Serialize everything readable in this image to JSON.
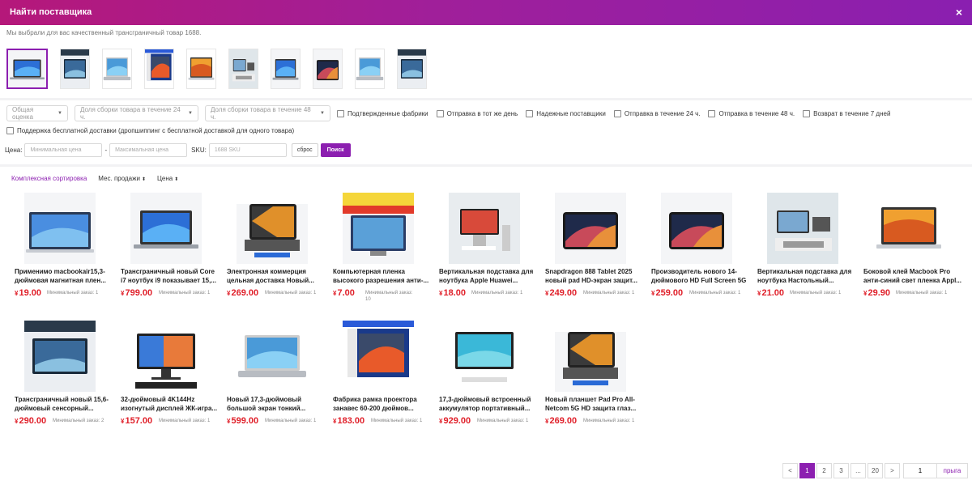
{
  "header": {
    "title": "Найти поставщика",
    "close_label": "×"
  },
  "subtitle": "Мы выбрали для вас качественный трансграничный товар 1688.",
  "thumbnails": [
    "laptop-1",
    "poster-1",
    "laptop-2",
    "screen-1",
    "screen-2",
    "dock-1",
    "laptop-3",
    "dark-1",
    "laptop-4",
    "laptop-5"
  ],
  "filters": {
    "rating": "Общая оценка",
    "pack24": "Доля сборки товара в течение 24 ч.",
    "pack48": "Доля сборки товара в течение 48 ч.",
    "checkboxes": [
      "Подтвержденные фабрики",
      "Отправка в тот же день",
      "Надежные поставщики",
      "Отправка в течение 24 ч.",
      "Отправка в течение 48 ч.",
      "Возврат в течение 7 дней"
    ],
    "free_shipping": "Поддержка бесплатной доставки (дропшиппинг с бесплатной доставкой для одного товара)"
  },
  "price_filter": {
    "label": "Цена:",
    "min_placeholder": "Минимальная цена",
    "dash": "-",
    "max_placeholder": "Максимальная цена",
    "sku_label": "SKU:",
    "sku_placeholder": "1688 SKU",
    "reset": "сброс",
    "search": "Поиск"
  },
  "sort": {
    "complex": "Комплексная сортировка",
    "sales": "Мес. продажи",
    "price": "Цена",
    "arrows": "⬍"
  },
  "currency": "¥",
  "products": [
    {
      "name": "Применимо macbookair15,3-дюймовая магнитная плен...",
      "price": "19.00",
      "moq": "Минимальный заказ: 1",
      "img": "screen-film"
    },
    {
      "name": "Трансграничный новый Core i7 ноутбук i9 показывает 15,...",
      "price": "799.00",
      "moq": "Минимальный заказ: 1",
      "img": "laptop"
    },
    {
      "name": "Электронная коммерция цельная доставка Новый...",
      "price": "269.00",
      "moq": "Минимальный заказ: 1",
      "img": "tablet-kb"
    },
    {
      "name": "Компьютерная пленка высокого разрешения анти-...",
      "price": "7.00",
      "moq": "Минимальный заказ: 10",
      "img": "privacy"
    },
    {
      "name": "Вертикальная подставка для ноутбука Apple Huawei...",
      "price": "18.00",
      "moq": "Минимальный заказ: 1",
      "img": "stand"
    },
    {
      "name": "Snapdragon 888 Tablet 2025 новый pad HD-экран защит...",
      "price": "249.00",
      "moq": "Минимальный заказ: 1",
      "img": "tablet"
    },
    {
      "name": "Производитель нового 14-дюймового HD Full Screen 5G",
      "price": "259.00",
      "moq": "Минимальный заказ: 1",
      "img": "tablet"
    },
    {
      "name": "Вертикальная подставка для ноутбука Настольный...",
      "price": "21.00",
      "moq": "Минимальный заказ: 1",
      "img": "stand2"
    },
    {
      "name": "Боковой клей Macbook Pro анти-синий свет пленка Appl...",
      "price": "29.90",
      "moq": "Минимальный заказ: 1",
      "img": "mac-film"
    },
    {
      "name": "Трансграничный новый 15,6-дюймовый сенсорный...",
      "price": "290.00",
      "moq": "Минимальный заказ: 2",
      "img": "portable"
    },
    {
      "name": "32-дюймовый 4K144Hz изогнутый дисплей ЖК-игра...",
      "price": "157.00",
      "moq": "Минимальный заказ: 1",
      "img": "monitor2k"
    },
    {
      "name": "Новый 17,3-дюймовый большой экран тонкий...",
      "price": "599.00",
      "moq": "Минимальный заказ: 1",
      "img": "laptop-silver"
    },
    {
      "name": "Фабрика рамка проектора занавес 60-200 дюймов...",
      "price": "183.00",
      "moq": "Минимальный заказ: 1",
      "img": "projector"
    },
    {
      "name": "17,3-дюймовый встроенный аккумулятор портативный...",
      "price": "929.00",
      "moq": "Минимальный заказ: 1",
      "img": "portable2"
    },
    {
      "name": "Новый планшет Pad Pro All-Netcom 5G HD защита глаз...",
      "price": "269.00",
      "moq": "Минимальный заказ: 1",
      "img": "tablet-kb"
    }
  ],
  "pagination": {
    "prev": "<",
    "pages": [
      "1",
      "2",
      "3",
      "...",
      "20"
    ],
    "next": ">",
    "jump_value": "1",
    "go": "прыга"
  },
  "colors": {
    "accent": "#8c1fb0",
    "price": "#e0202a",
    "header_start": "#b5187a",
    "header_end": "#8a1fb0"
  }
}
